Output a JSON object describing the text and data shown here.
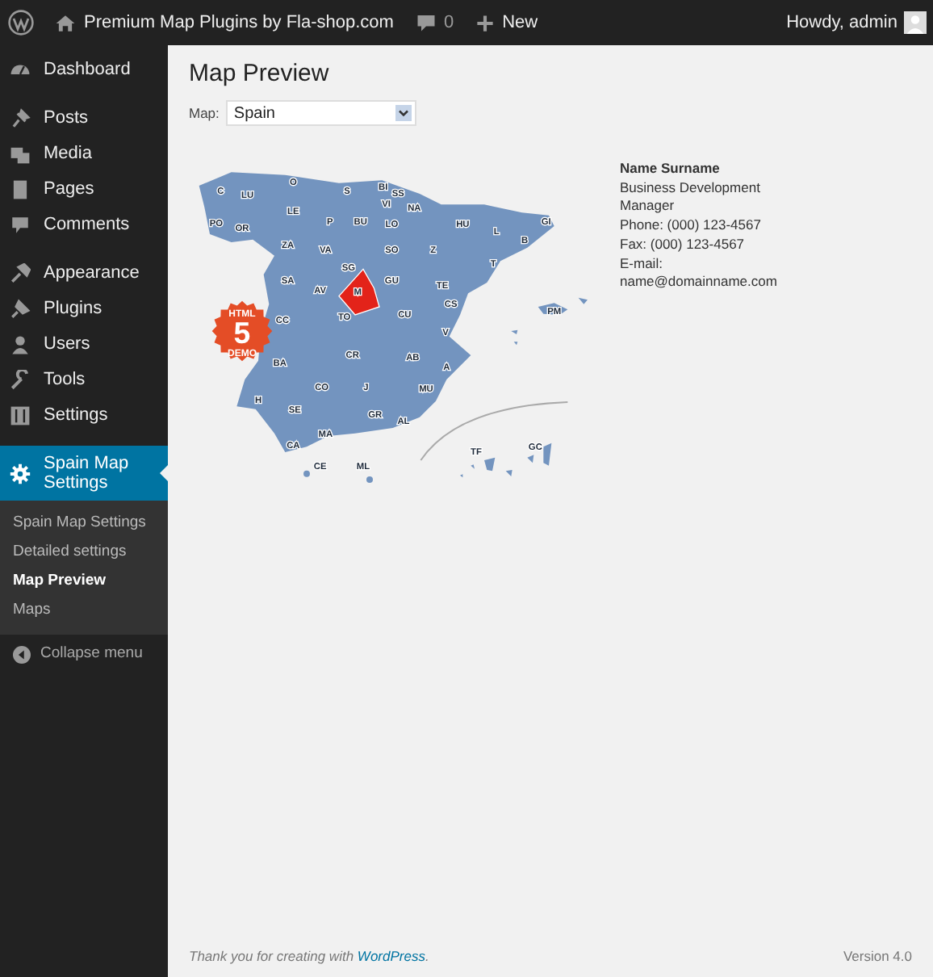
{
  "admin_bar": {
    "site_title": "Premium Map Plugins by Fla-shop.com",
    "comments_count": "0",
    "new_label": "New",
    "greeting": "Howdy, admin"
  },
  "sidebar": {
    "menu_groups": [
      [
        {
          "label": "Dashboard",
          "selected": false
        }
      ],
      [
        {
          "label": "Posts",
          "selected": false
        },
        {
          "label": "Media",
          "selected": false
        },
        {
          "label": "Pages",
          "selected": false
        },
        {
          "label": "Comments",
          "selected": false
        }
      ],
      [
        {
          "label": "Appearance",
          "selected": false
        },
        {
          "label": "Plugins",
          "selected": false
        },
        {
          "label": "Users",
          "selected": false
        },
        {
          "label": "Tools",
          "selected": false
        },
        {
          "label": "Settings",
          "selected": false
        }
      ],
      [
        {
          "label": "Spain Map Settings",
          "selected": true
        }
      ]
    ],
    "submenu": [
      {
        "label": "Spain Map Settings",
        "selected": false
      },
      {
        "label": "Detailed settings",
        "selected": false
      },
      {
        "label": "Map Preview",
        "selected": true
      },
      {
        "label": "Maps",
        "selected": false
      }
    ],
    "collapse_label": "Collapse menu"
  },
  "page": {
    "title": "Map Preview",
    "map_label": "Map:",
    "map_select": "Spain"
  },
  "map": {
    "badge": {
      "top": "HTML",
      "number": "5",
      "bottom": "DEMO"
    },
    "regions": [
      {
        "label": "C",
        "selected": false
      },
      {
        "label": "LU",
        "selected": false
      },
      {
        "label": "O",
        "selected": false
      },
      {
        "label": "S",
        "selected": false
      },
      {
        "label": "BI",
        "selected": false
      },
      {
        "label": "SS",
        "selected": false
      },
      {
        "label": "VI",
        "selected": false
      },
      {
        "label": "NA",
        "selected": false
      },
      {
        "label": "PO",
        "selected": false
      },
      {
        "label": "OR",
        "selected": false
      },
      {
        "label": "LE",
        "selected": false
      },
      {
        "label": "P",
        "selected": false
      },
      {
        "label": "BU",
        "selected": false
      },
      {
        "label": "LO",
        "selected": false
      },
      {
        "label": "HU",
        "selected": false
      },
      {
        "label": "L",
        "selected": false
      },
      {
        "label": "GI",
        "selected": false
      },
      {
        "label": "B",
        "selected": false
      },
      {
        "label": "ZA",
        "selected": false
      },
      {
        "label": "VA",
        "selected": false
      },
      {
        "label": "SO",
        "selected": false
      },
      {
        "label": "Z",
        "selected": false
      },
      {
        "label": "T",
        "selected": false
      },
      {
        "label": "SG",
        "selected": false
      },
      {
        "label": "SA",
        "selected": false
      },
      {
        "label": "AV",
        "selected": false
      },
      {
        "label": "M",
        "selected": true
      },
      {
        "label": "GU",
        "selected": false
      },
      {
        "label": "TE",
        "selected": false
      },
      {
        "label": "CS",
        "selected": false
      },
      {
        "label": "PM",
        "selected": false
      },
      {
        "label": "CC",
        "selected": false
      },
      {
        "label": "TO",
        "selected": false
      },
      {
        "label": "CU",
        "selected": false
      },
      {
        "label": "V",
        "selected": false
      },
      {
        "label": "BA",
        "selected": false
      },
      {
        "label": "CR",
        "selected": false
      },
      {
        "label": "AB",
        "selected": false
      },
      {
        "label": "A",
        "selected": false
      },
      {
        "label": "H",
        "selected": false
      },
      {
        "label": "CO",
        "selected": false
      },
      {
        "label": "J",
        "selected": false
      },
      {
        "label": "MU",
        "selected": false
      },
      {
        "label": "SE",
        "selected": false
      },
      {
        "label": "GR",
        "selected": false
      },
      {
        "label": "AL",
        "selected": false
      },
      {
        "label": "MA",
        "selected": false
      },
      {
        "label": "CA",
        "selected": false
      },
      {
        "label": "CE",
        "selected": false
      },
      {
        "label": "ML",
        "selected": false
      },
      {
        "label": "TF",
        "selected": false
      },
      {
        "label": "GC",
        "selected": false
      }
    ]
  },
  "contact": [
    "Name Surname",
    "Business Development",
    "Manager",
    "Phone: (000) 123-4567",
    "Fax: (000) 123-4567",
    "E-mail:",
    "name@domainname.com"
  ],
  "footer": {
    "thanks": "Thank you for creating with ",
    "link": "WordPress",
    "after": ".",
    "version": "Version 4.0"
  }
}
